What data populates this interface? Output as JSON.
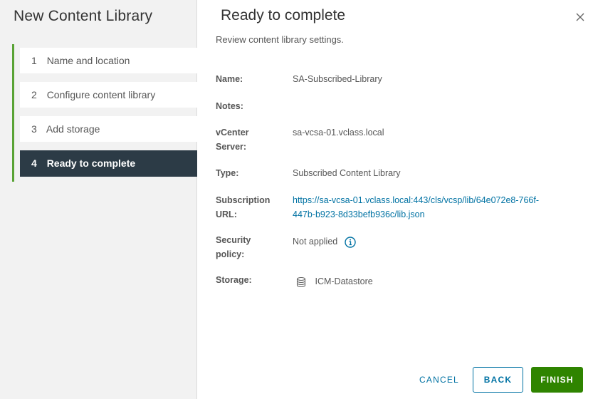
{
  "wizard": {
    "title": "New Content Library",
    "steps": [
      {
        "num": "1",
        "label": "Name and location"
      },
      {
        "num": "2",
        "label": "Configure content library"
      },
      {
        "num": "3",
        "label": "Add storage"
      },
      {
        "num": "4",
        "label": "Ready to complete"
      }
    ]
  },
  "page": {
    "title": "Ready to complete",
    "subtitle": "Review content library settings."
  },
  "fields": {
    "name": {
      "label": "Name:",
      "value": "SA-Subscribed-Library"
    },
    "notes": {
      "label": "Notes:",
      "value": ""
    },
    "vcenter": {
      "label_line1": "vCenter",
      "label_line2": "Server:",
      "value": "sa-vcsa-01.vclass.local"
    },
    "type": {
      "label": "Type:",
      "value": "Subscribed Content Library"
    },
    "subscription": {
      "label_line1": "Subscription",
      "label_line2": "URL:",
      "value_line1": "https://sa-vcsa-01.vclass.local:443/cls/vcsp/lib/64e072e8-766f-",
      "value_line2": "447b-b923-8d33befb936c/lib.json"
    },
    "security": {
      "label_line1": "Security",
      "label_line2": "policy:",
      "value": "Not applied"
    },
    "storage": {
      "label": "Storage:",
      "value": "ICM-Datastore"
    }
  },
  "buttons": {
    "cancel": "CANCEL",
    "back": "BACK",
    "finish": "FINISH"
  },
  "colors": {
    "accent_green": "#59a335",
    "active_step_bg": "#2c3b46",
    "link_blue": "#0072a3",
    "finish_green": "#2f8400"
  }
}
